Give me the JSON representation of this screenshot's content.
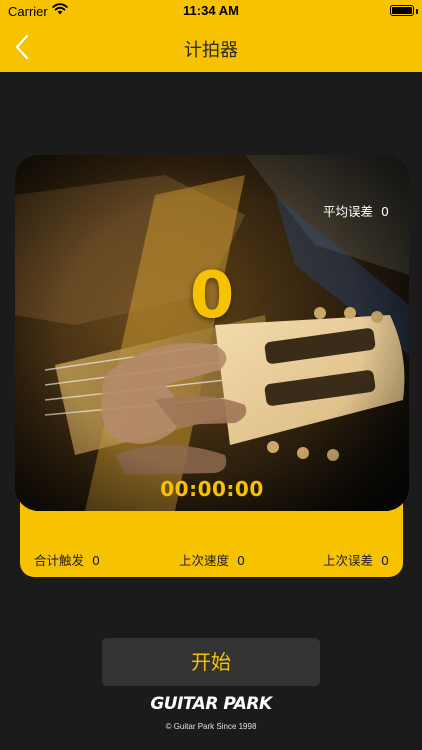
{
  "status_bar": {
    "carrier": "Carrier",
    "time": "11:34 AM",
    "battery_level": 1.0
  },
  "nav": {
    "title": "计拍器",
    "back_icon": "chevron-left-icon"
  },
  "metronome": {
    "avg_error_label": "平均误差",
    "avg_error_value": "0",
    "beat_count": "0",
    "timer": "00:00:00"
  },
  "stats": {
    "total_label": "合计触发",
    "total_value": "0",
    "last_speed_label": "上次速度",
    "last_speed_value": "0",
    "last_error_label": "上次误差",
    "last_error_value": "0"
  },
  "controls": {
    "start_label": "开始"
  },
  "footer": {
    "brand": "GUITAR PARK",
    "copyright": "© Guitar Park  Since 1998"
  },
  "colors": {
    "accent": "#f7c300",
    "background": "#1b1b1b",
    "button": "#333333"
  }
}
